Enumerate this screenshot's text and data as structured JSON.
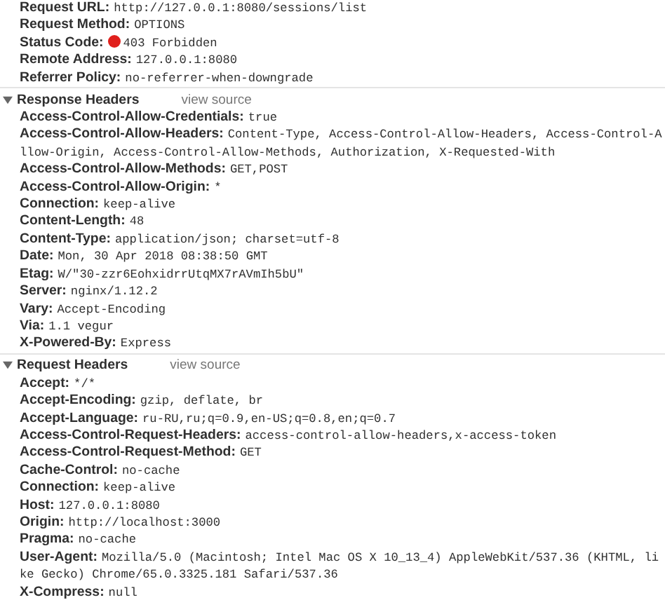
{
  "general": {
    "rows": [
      {
        "name": "Request URL:",
        "value": "http://127.0.0.1:8080/sessions/list"
      },
      {
        "name": "Request Method:",
        "value": "OPTIONS"
      },
      {
        "name": "Status Code:",
        "value": "403 Forbidden",
        "color": "#e0201c"
      },
      {
        "name": "Remote Address:",
        "value": "127.0.0.1:8080"
      },
      {
        "name": "Referrer Policy:",
        "value": "no-referrer-when-downgrade"
      }
    ]
  },
  "sections": [
    {
      "title": "Response Headers",
      "expanded": true,
      "link": "view source",
      "rows": [
        {
          "name": "Access-Control-Allow-Credentials:",
          "value": "true"
        },
        {
          "name": "Access-Control-Allow-Headers:",
          "value": "Content-Type, Access-Control-Allow-Headers, Access-Control-Allow-Origin, Access-Control-Allow-Methods, Authorization, X-Requested-With"
        },
        {
          "name": "Access-Control-Allow-Methods:",
          "value": "GET,POST"
        },
        {
          "name": "Access-Control-Allow-Origin:",
          "value": "*"
        },
        {
          "name": "Connection:",
          "value": "keep-alive"
        },
        {
          "name": "Content-Length:",
          "value": "48"
        },
        {
          "name": "Content-Type:",
          "value": "application/json; charset=utf-8"
        },
        {
          "name": "Date:",
          "value": "Mon, 30 Apr 2018 08:38:50 GMT"
        },
        {
          "name": "Etag:",
          "value": "W/\"30-zzr6EohxidrrUtqMX7rAVmIh5bU\""
        },
        {
          "name": "Server:",
          "value": "nginx/1.12.2"
        },
        {
          "name": "Vary:",
          "value": "Accept-Encoding"
        },
        {
          "name": "Via:",
          "value": "1.1 vegur"
        },
        {
          "name": "X-Powered-By:",
          "value": "Express"
        }
      ]
    },
    {
      "title": "Request Headers",
      "expanded": true,
      "link": "view source",
      "rows": [
        {
          "name": "Accept:",
          "value": "*/*"
        },
        {
          "name": "Accept-Encoding:",
          "value": "gzip, deflate, br"
        },
        {
          "name": "Accept-Language:",
          "value": "ru-RU,ru;q=0.9,en-US;q=0.8,en;q=0.7"
        },
        {
          "name": "Access-Control-Request-Headers:",
          "value": "access-control-allow-headers,x-access-token"
        },
        {
          "name": "Access-Control-Request-Method:",
          "value": "GET"
        },
        {
          "name": "Cache-Control:",
          "value": "no-cache"
        },
        {
          "name": "Connection:",
          "value": "keep-alive"
        },
        {
          "name": "Host:",
          "value": "127.0.0.1:8080"
        },
        {
          "name": "Origin:",
          "value": "http://localhost:3000"
        },
        {
          "name": "Pragma:",
          "value": "no-cache"
        },
        {
          "name": "User-Agent:",
          "value": "Mozilla/5.0 (Macintosh; Intel Mac OS X 10_13_4) AppleWebKit/537.36 (KHTML, like Gecko) Chrome/65.0.3325.181 Safari/537.36"
        },
        {
          "name": "X-Compress:",
          "value": "null"
        }
      ]
    }
  ]
}
